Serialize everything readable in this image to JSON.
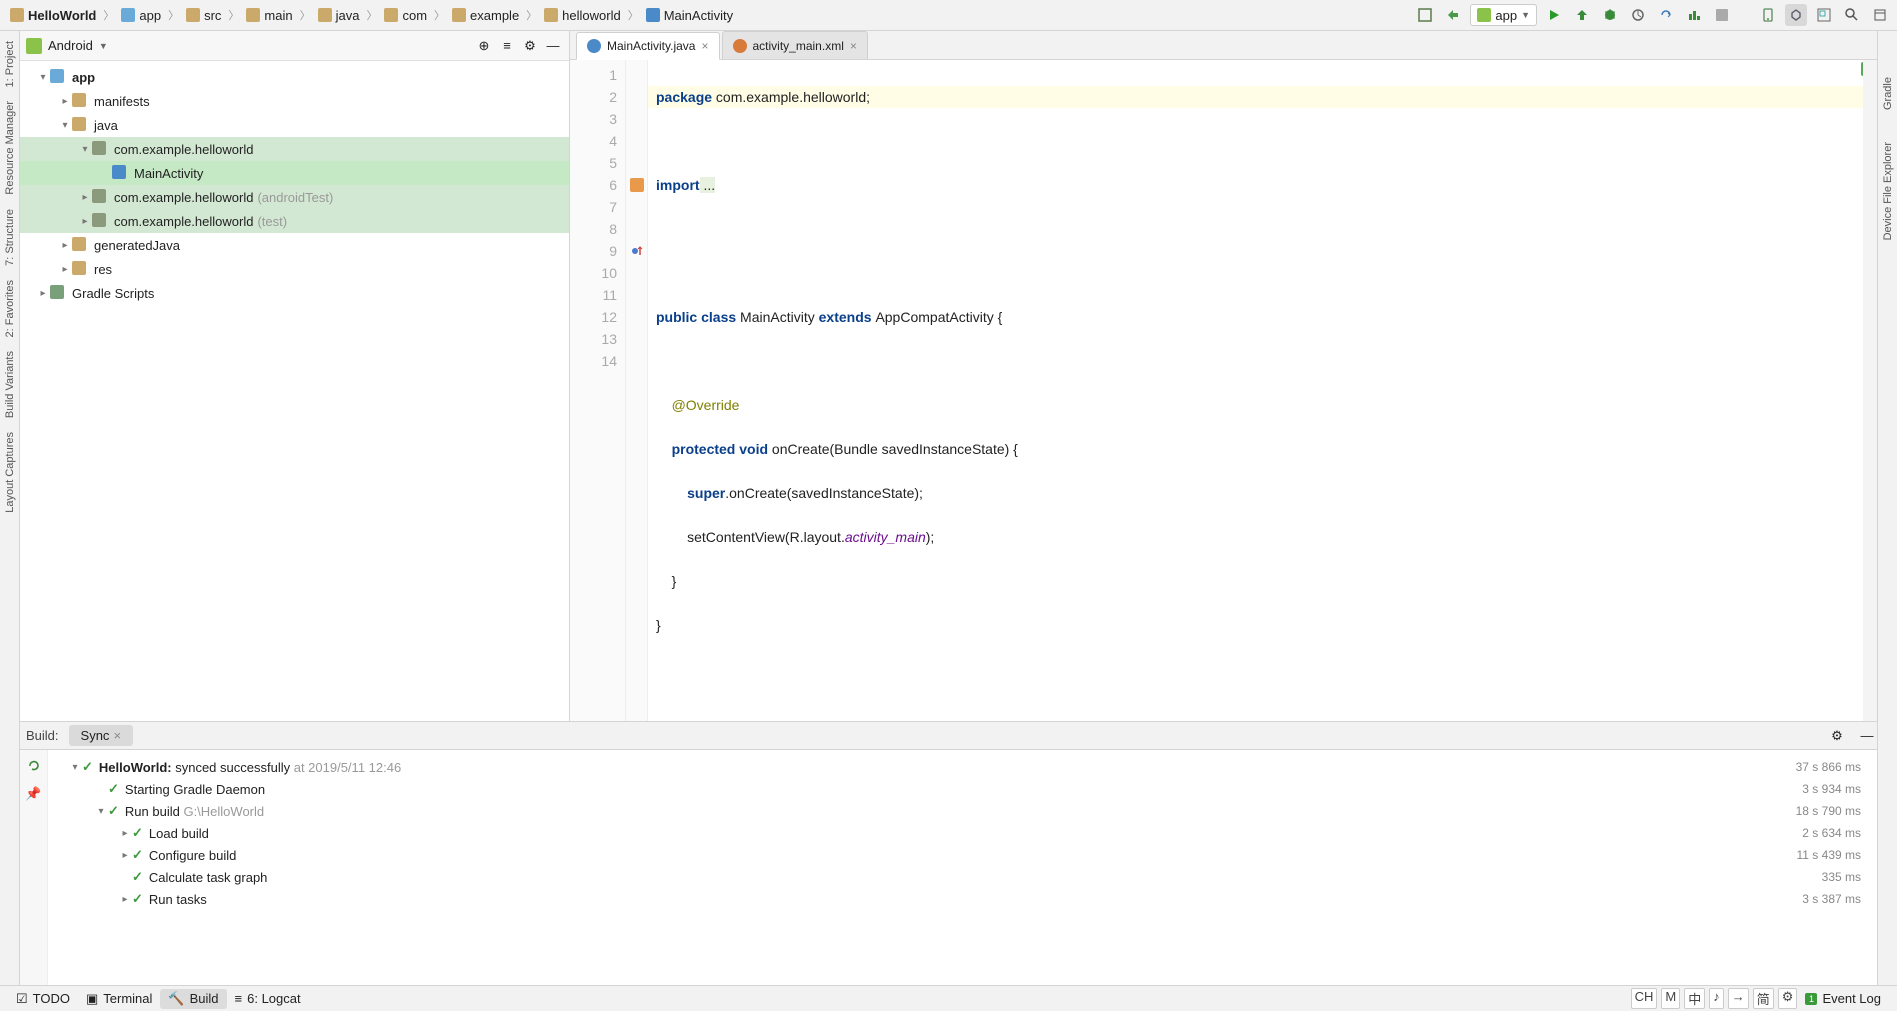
{
  "breadcrumbs": [
    {
      "label": "HelloWorld",
      "bold": true,
      "icon": "project"
    },
    {
      "label": "app",
      "icon": "module-folder"
    },
    {
      "label": "src",
      "icon": "folder"
    },
    {
      "label": "main",
      "icon": "folder"
    },
    {
      "label": "java",
      "icon": "folder"
    },
    {
      "label": "com",
      "icon": "folder"
    },
    {
      "label": "example",
      "icon": "folder"
    },
    {
      "label": "helloworld",
      "icon": "folder"
    },
    {
      "label": "MainActivity",
      "icon": "class"
    }
  ],
  "runConfig": {
    "label": "app"
  },
  "projectView": {
    "label": "Android"
  },
  "tree": [
    {
      "indent": 0,
      "arrow": "▾",
      "icon": "module",
      "label": "app",
      "bold": true
    },
    {
      "indent": 1,
      "arrow": "▸",
      "icon": "folder-m",
      "label": "manifests"
    },
    {
      "indent": 1,
      "arrow": "▾",
      "icon": "folder-j",
      "label": "java"
    },
    {
      "indent": 2,
      "arrow": "▾",
      "icon": "package",
      "label": "com.example.helloworld",
      "sel": "sel"
    },
    {
      "indent": 3,
      "arrow": "",
      "icon": "class-c",
      "label": "MainActivity",
      "sel": "sel-strong"
    },
    {
      "indent": 2,
      "arrow": "▸",
      "icon": "package",
      "label": "com.example.helloworld",
      "suffix": "(androidTest)",
      "sel": "sel"
    },
    {
      "indent": 2,
      "arrow": "▸",
      "icon": "package",
      "label": "com.example.helloworld",
      "suffix": "(test)",
      "sel": "sel"
    },
    {
      "indent": 1,
      "arrow": "▸",
      "icon": "folder-g",
      "label": "generatedJava"
    },
    {
      "indent": 1,
      "arrow": "▸",
      "icon": "folder-r",
      "label": "res"
    },
    {
      "indent": 0,
      "arrow": "▸",
      "icon": "gradle",
      "label": "Gradle Scripts"
    }
  ],
  "tabs": [
    {
      "label": "MainActivity.java",
      "icon": "class-c",
      "active": true,
      "closable": true
    },
    {
      "label": "activity_main.xml",
      "icon": "xml",
      "active": false,
      "closable": true
    }
  ],
  "code": {
    "lines": [
      "1",
      "2",
      "3",
      "4",
      "5",
      "6",
      "7",
      "8",
      "9",
      "10",
      "11",
      "12",
      "13",
      "14"
    ],
    "l1_kw": "package",
    "l1_rest": " com.example.helloworld;",
    "l3_kw": "import",
    "l3_rest": " ...",
    "l6_kw1": "public class ",
    "l6_name": "MainActivity ",
    "l6_kw2": "extends ",
    "l6_sup": "AppCompatActivity {",
    "l8_ann": "@Override",
    "l9_kw": "protected void ",
    "l9_name": "onCreate",
    "l9_args": "(Bundle savedInstanceState) {",
    "l10_kw": "super",
    "l10_rest": ".onCreate(savedInstanceState);",
    "l11_a": "setContentView(R.layout.",
    "l11_b": "activity_main",
    "l11_c": ");",
    "l12": "}",
    "l13": "}"
  },
  "build": {
    "panelLabel": "Build:",
    "tab": "Sync",
    "rows": [
      {
        "indent": 0,
        "arrow": "▾",
        "ok": true,
        "bold": "HelloWorld:",
        "text": " synced successfully",
        "sec": " at 2019/5/11 12:46",
        "time": "37 s 866 ms"
      },
      {
        "indent": 1,
        "arrow": "",
        "ok": true,
        "text": "Starting Gradle Daemon",
        "time": "3 s 934 ms"
      },
      {
        "indent": 1,
        "arrow": "▾",
        "ok": true,
        "text": "Run build ",
        "sec": "G:\\HelloWorld",
        "time": "18 s 790 ms"
      },
      {
        "indent": 2,
        "arrow": "▸",
        "ok": true,
        "text": "Load build",
        "time": "2 s 634 ms"
      },
      {
        "indent": 2,
        "arrow": "▸",
        "ok": true,
        "text": "Configure build",
        "time": "11 s 439 ms"
      },
      {
        "indent": 2,
        "arrow": "",
        "ok": true,
        "text": "Calculate task graph",
        "time": "335 ms"
      },
      {
        "indent": 2,
        "arrow": "▸",
        "ok": true,
        "text": "Run tasks",
        "time": "3 s 387 ms"
      }
    ]
  },
  "status": {
    "todo": "TODO",
    "terminal": "Terminal",
    "build": "Build",
    "logcat": "6: Logcat",
    "eventlog": "Event Log",
    "ime": [
      "CH",
      "M",
      "中",
      "♪",
      "→",
      "简",
      "⚙"
    ]
  },
  "leftRail": [
    "1: Project",
    "Resource Manager",
    "7: Structure",
    "2: Favorites",
    "Build Variants",
    "Layout Captures"
  ],
  "rightRail": [
    "Gradle",
    "Device File Explorer"
  ]
}
